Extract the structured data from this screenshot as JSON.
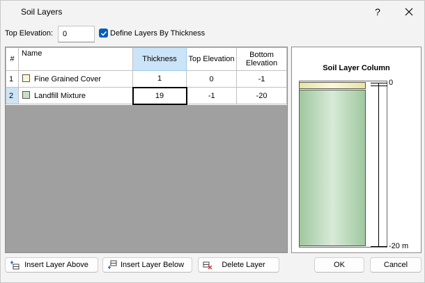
{
  "window": {
    "title": "Soil Layers",
    "help": "?"
  },
  "top_elevation": {
    "label": "Top Elevation:",
    "value": "0"
  },
  "define_by_thickness": {
    "label": "Define Layers By Thickness",
    "checked": true
  },
  "table": {
    "headers": {
      "num": "#",
      "name": "Name",
      "thickness": "Thickness",
      "top": "Top Elevation",
      "bottom": "Bottom Elevation"
    },
    "rows": [
      {
        "num": "1",
        "name": "Fine Grained Cover",
        "color": "#fbf8d0",
        "thickness": "1",
        "top": "0",
        "bottom": "-1"
      },
      {
        "num": "2",
        "name": "Landfill Mixture",
        "color": "#c8e0c8",
        "thickness": "19",
        "top": "-1",
        "bottom": "-20"
      }
    ]
  },
  "column": {
    "title": "Soil Layer Column",
    "top_label": "0",
    "bottom_label": "-20 m"
  },
  "buttons": {
    "insert_above": "Insert Layer Above",
    "insert_below": "Insert Layer Below",
    "delete": "Delete Layer",
    "ok": "OK",
    "cancel": "Cancel"
  }
}
